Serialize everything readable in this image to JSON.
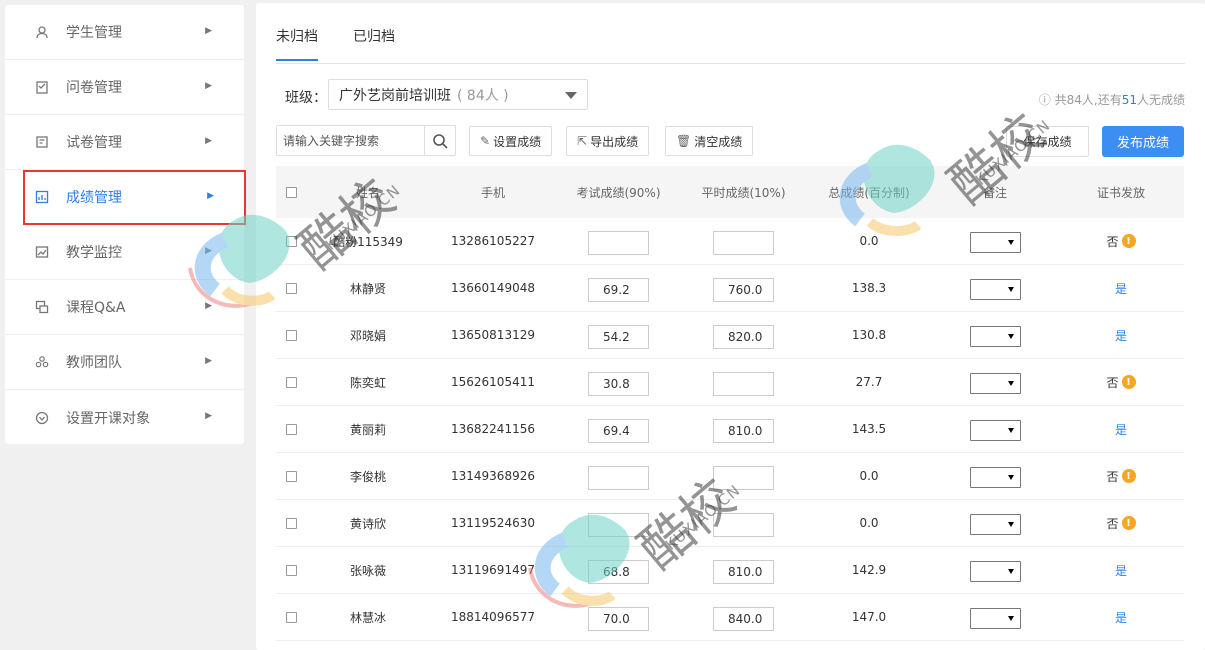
{
  "sidebar": {
    "items": [
      {
        "label": "学生管理",
        "icon": "student-icon"
      },
      {
        "label": "问卷管理",
        "icon": "survey-icon"
      },
      {
        "label": "试卷管理",
        "icon": "exam-icon"
      },
      {
        "label": "成绩管理",
        "icon": "grades-icon",
        "active": true
      },
      {
        "label": "教学监控",
        "icon": "monitor-icon"
      },
      {
        "label": "课程Q&A",
        "icon": "qa-icon"
      },
      {
        "label": "教师团队",
        "icon": "team-icon"
      },
      {
        "label": "设置开课对象",
        "icon": "target-icon"
      }
    ]
  },
  "tabs": [
    "未归档",
    "已归档"
  ],
  "filter": {
    "class_label": "班级：",
    "class_name": "广外艺岗前培训班",
    "class_count": "( 84人 )",
    "stats_prefix": "共84人,还有",
    "stats_count": "51",
    "stats_suffix": "人无成绩"
  },
  "toolbar": {
    "search_placeholder": "请输入关键字搜索",
    "set_score": "设置成绩",
    "export_score": "导出成绩",
    "clear_score": "清空成绩",
    "save_score": "保存成绩",
    "publish_score": "发布成绩"
  },
  "table": {
    "headers": [
      "姓名",
      "手机",
      "考试成绩(90%)",
      "平时成绩(10%)",
      "总成绩(百分制)",
      "备注",
      "证书发放"
    ],
    "rows": [
      {
        "name": "酷粉115349",
        "phone": "13286105227",
        "exam": "",
        "usual": "",
        "total": "0.0",
        "cert": "否",
        "warn": true
      },
      {
        "name": "林静贤",
        "phone": "13660149048",
        "exam": "69.2",
        "usual": "760.0",
        "total": "138.3",
        "cert": "是",
        "warn": false
      },
      {
        "name": "邓晓娟",
        "phone": "13650813129",
        "exam": "54.2",
        "usual": "820.0",
        "total": "130.8",
        "cert": "是",
        "warn": false
      },
      {
        "name": "陈奕虹",
        "phone": "15626105411",
        "exam": "30.8",
        "usual": "",
        "total": "27.7",
        "cert": "否",
        "warn": true
      },
      {
        "name": "黄丽莉",
        "phone": "13682241156",
        "exam": "69.4",
        "usual": "810.0",
        "total": "143.5",
        "cert": "是",
        "warn": false
      },
      {
        "name": "李俊桃",
        "phone": "13149368926",
        "exam": "",
        "usual": "",
        "total": "0.0",
        "cert": "否",
        "warn": true
      },
      {
        "name": "黄诗欣",
        "phone": "13119524630",
        "exam": "",
        "usual": "",
        "total": "0.0",
        "cert": "否",
        "warn": true
      },
      {
        "name": "张咏薇",
        "phone": "13119691497",
        "exam": "68.8",
        "usual": "810.0",
        "total": "142.9",
        "cert": "是",
        "warn": false
      },
      {
        "name": "林慧冰",
        "phone": "18814096577",
        "exam": "70.0",
        "usual": "840.0",
        "total": "147.0",
        "cert": "是",
        "warn": false
      }
    ]
  },
  "watermark": {
    "text": "酷校",
    "sub": "KUXIAO.CN"
  },
  "colors": {
    "accent": "#2f7fe6",
    "publish": "#3d8ef2",
    "warn": "#f5a623",
    "highlight": "#e53935"
  }
}
